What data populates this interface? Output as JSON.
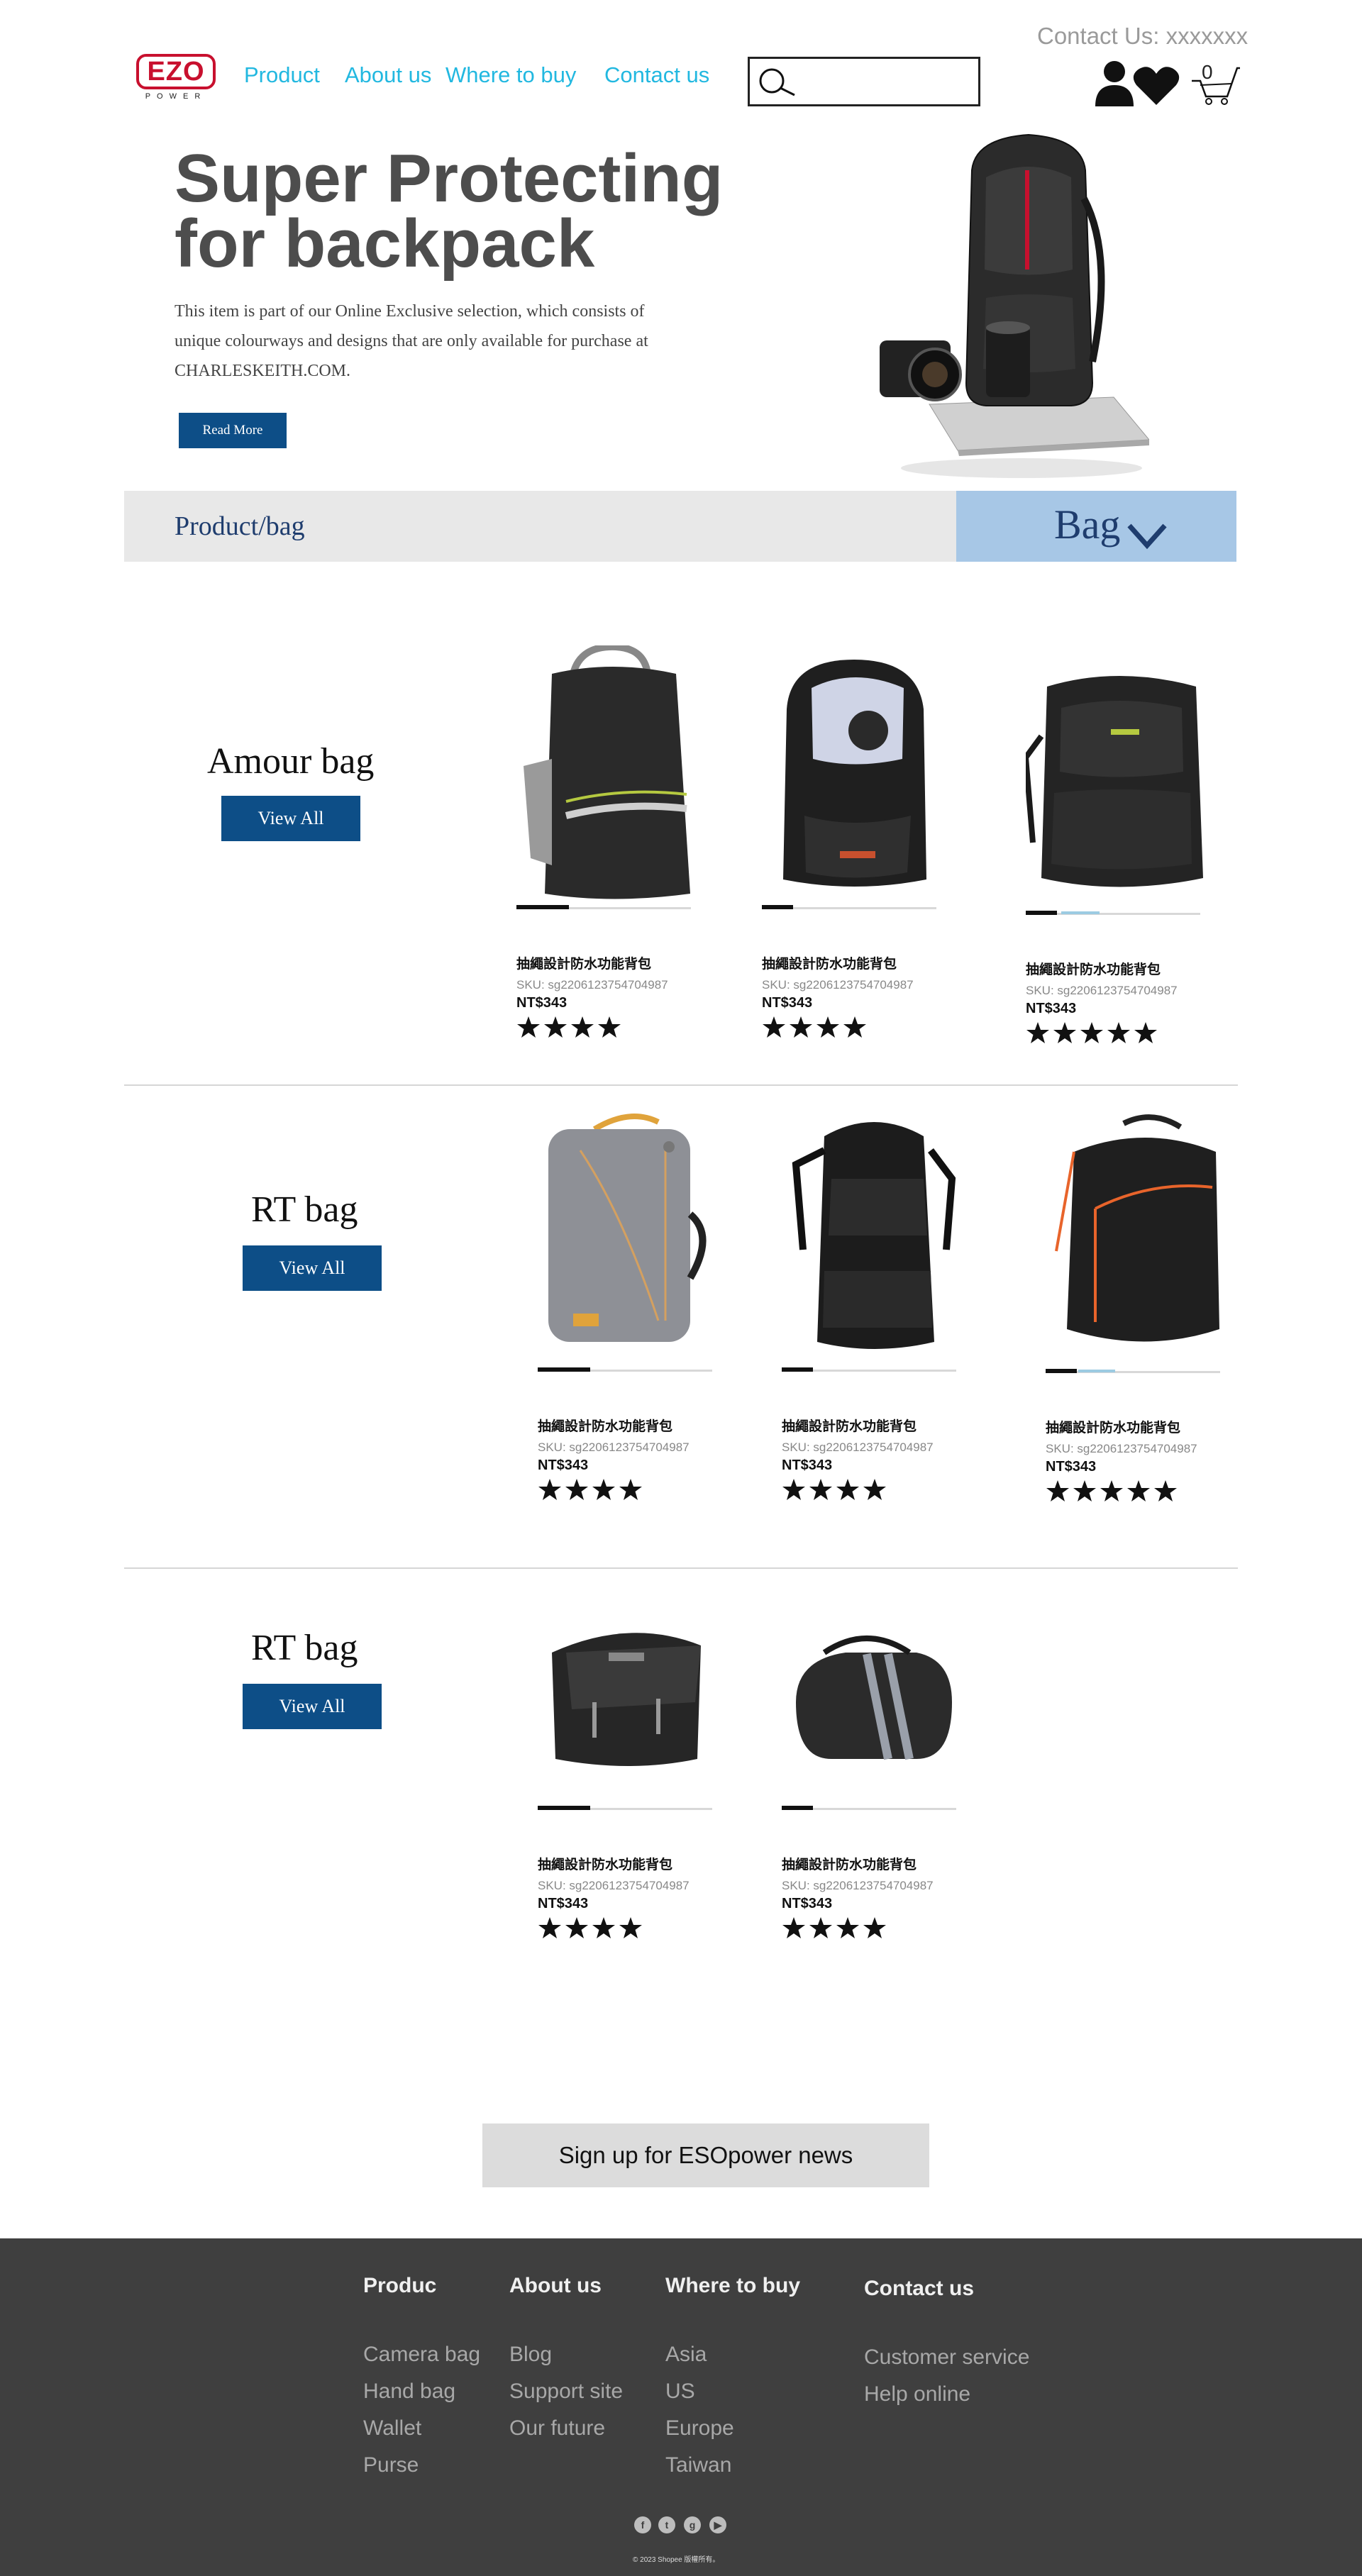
{
  "header": {
    "contact_top": "Contact Us: xxxxxxx",
    "logo_text": "EZO",
    "logo_sub": "POWER",
    "nav": [
      "Product",
      "About us",
      "Where to buy",
      "Contact us"
    ],
    "search_placeholder": "",
    "cart_count": "0"
  },
  "hero": {
    "title_line1": "Super Protecting",
    "title_line2": "for backpack",
    "desc_line1": "This item is part of our Online Exclusive selection, which consists of",
    "desc_line2": "unique colourways and designs that are only available for purchase at",
    "desc_line3": "CHARLESKEITH.COM.",
    "cta": "Read More"
  },
  "category_bar": {
    "breadcrumb": "Product/bag",
    "selected": "Bag"
  },
  "sections": [
    {
      "title": "Amour bag",
      "view_all": "View All",
      "products": [
        {
          "name": "抽繩設計防水功能背包",
          "sku": "SKU: sg2206123754704987",
          "price": "NT$343",
          "rating": 4,
          "bar_progress": 0.3
        },
        {
          "name": "抽繩設計防水功能背包",
          "sku": "SKU: sg2206123754704987",
          "price": "NT$343",
          "rating": 4,
          "bar_progress": 0.18
        },
        {
          "name": "抽繩設計防水功能背包",
          "sku": "SKU: sg2206123754704987",
          "price": "NT$343",
          "rating": 5,
          "bar_progress": 0.18
        }
      ]
    },
    {
      "title": "RT bag",
      "view_all": "View All",
      "products": [
        {
          "name": "抽繩設計防水功能背包",
          "sku": "SKU: sg2206123754704987",
          "price": "NT$343",
          "rating": 4,
          "bar_progress": 0.3
        },
        {
          "name": "抽繩設計防水功能背包",
          "sku": "SKU: sg2206123754704987",
          "price": "NT$343",
          "rating": 4,
          "bar_progress": 0.18
        },
        {
          "name": "抽繩設計防水功能背包",
          "sku": "SKU: sg2206123754704987",
          "price": "NT$343",
          "rating": 5,
          "bar_progress": 0.18
        }
      ]
    },
    {
      "title": "RT bag",
      "view_all": "View All",
      "products": [
        {
          "name": "抽繩設計防水功能背包",
          "sku": "SKU: sg2206123754704987",
          "price": "NT$343",
          "rating": 4,
          "bar_progress": 0.3
        },
        {
          "name": "抽繩設計防水功能背包",
          "sku": "SKU: sg2206123754704987",
          "price": "NT$343",
          "rating": 4,
          "bar_progress": 0.18
        }
      ]
    }
  ],
  "newsletter": "Sign up for ESOpower news",
  "footer": {
    "columns": [
      {
        "heading": "Produc",
        "links": [
          "Camera bag",
          "Hand bag",
          "Wallet",
          "Purse"
        ]
      },
      {
        "heading": "About us",
        "links": [
          "Blog",
          "Support site",
          "Our future"
        ]
      },
      {
        "heading": "Where to buy",
        "links": [
          "Asia",
          "US",
          "Europe",
          "Taiwan"
        ]
      },
      {
        "heading": "Contact us",
        "links": [
          "Customer service",
          "Help online"
        ]
      }
    ],
    "social": [
      {
        "icon": "facebook-icon",
        "glyph": "f"
      },
      {
        "icon": "twitter-icon",
        "glyph": "t"
      },
      {
        "icon": "google-plus-icon",
        "glyph": "g"
      },
      {
        "icon": "youtube-icon",
        "glyph": "▶"
      }
    ],
    "copyright": "© 2023 Shopee 版權所有。"
  },
  "colors": {
    "brand_red": "#c8102e",
    "nav_link": "#22b8e0",
    "button_blue": "#0d4e87",
    "selected_category_bg": "#a7c7e6",
    "footer_bg": "#3f3f3f"
  }
}
